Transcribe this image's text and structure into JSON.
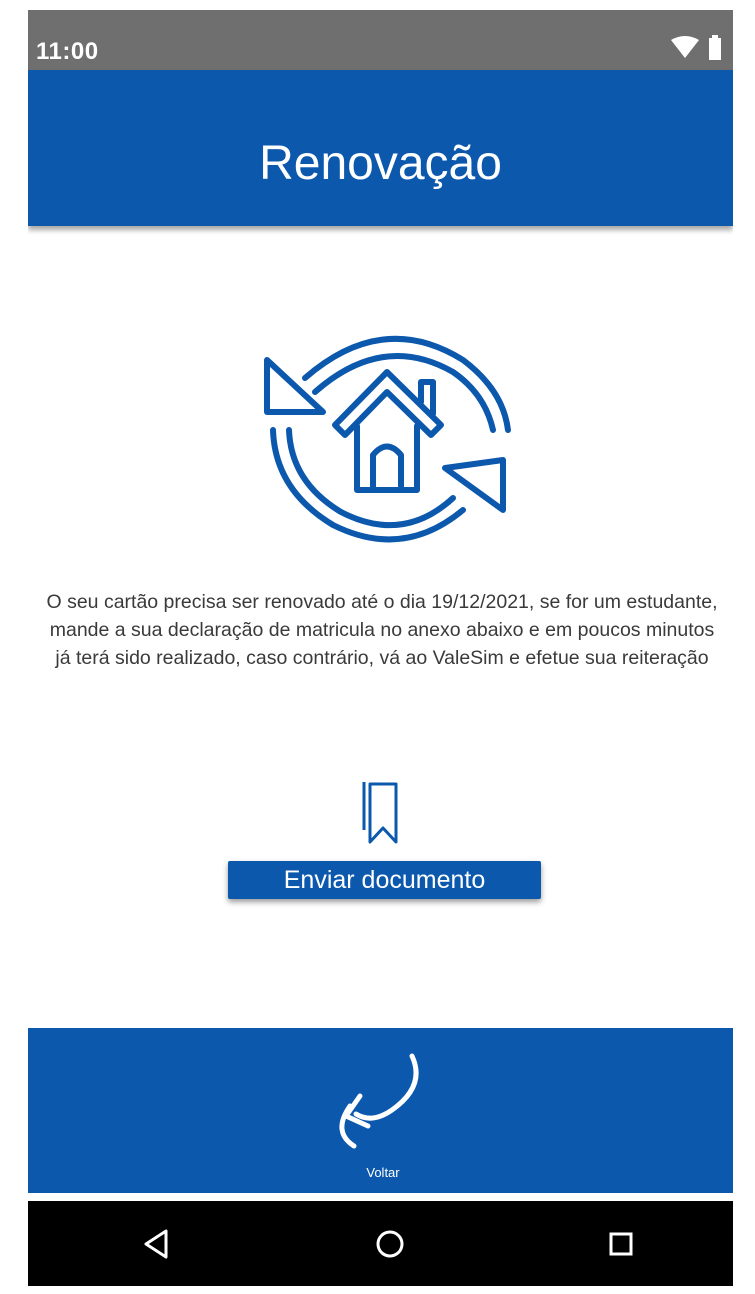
{
  "status_bar": {
    "time": "11:00",
    "icons": [
      "wifi-icon",
      "battery-icon"
    ]
  },
  "header": {
    "title": "Renovação"
  },
  "hero": {
    "icon": "home-renew-icon"
  },
  "message": {
    "text": "O seu cartão precisa ser renovado até o dia 19/12/2021, se for um estudante, mande a sua declaração de matricula no anexo abaixo e em poucos minutos já terá sido realizado, caso contrário, vá ao ValeSim e efetue sua reiteração"
  },
  "document": {
    "icon": "bookmark-document-icon",
    "button_label": "Enviar documento"
  },
  "bottom_bar": {
    "back_label": "Voltar",
    "back_icon": "return-arrow-icon"
  },
  "nav_bar": {
    "buttons": [
      "back-triangle-icon",
      "home-circle-icon",
      "recents-square-icon"
    ]
  },
  "colors": {
    "primary": "#0b58ad",
    "status_bar": "#6f6f6f",
    "nav_bar": "#000000",
    "text": "#3a3a3a"
  }
}
